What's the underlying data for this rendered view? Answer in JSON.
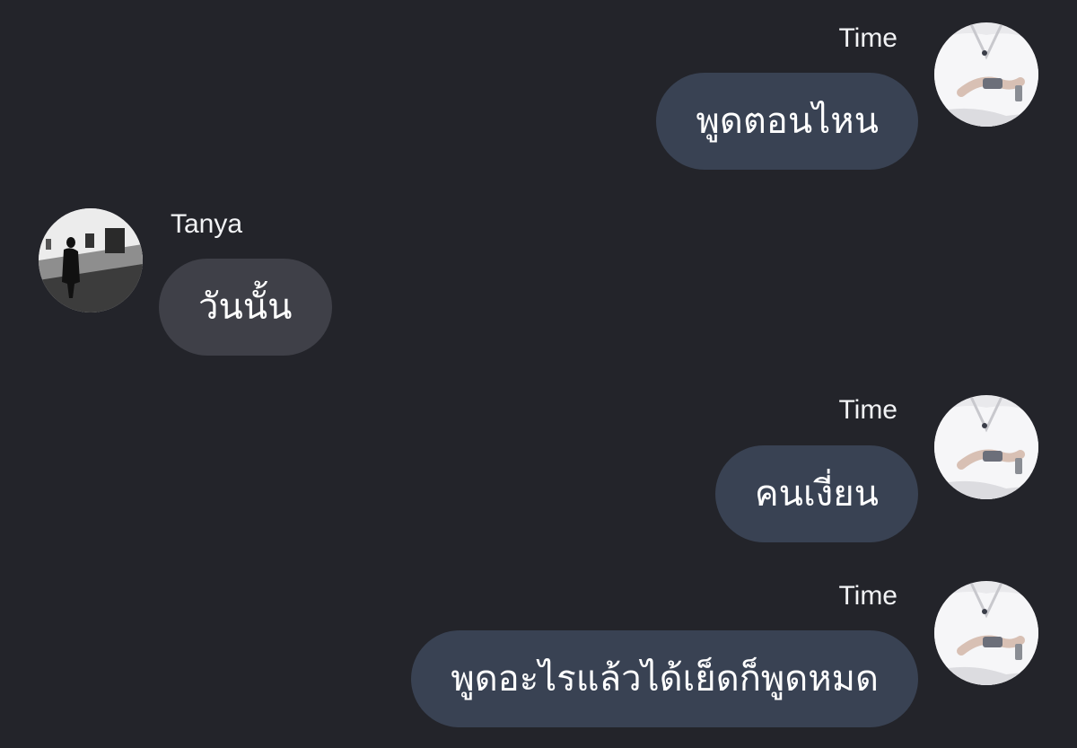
{
  "messages": [
    {
      "sender": "Time",
      "text": "พูดตอนไหน",
      "direction": "outgoing",
      "avatar": "person-white-shirt-phone-avatar"
    },
    {
      "sender": "Tanya",
      "text": "วันนั้น",
      "direction": "incoming",
      "avatar": "gallery-silhouette-avatar"
    },
    {
      "sender": "Time",
      "text": "คนเงี่ยน",
      "direction": "outgoing",
      "avatar": "person-white-shirt-phone-avatar"
    },
    {
      "sender": "Time",
      "text": "พูดอะไรแล้วได้เย็ดก็พูดหมด",
      "direction": "outgoing",
      "avatar": "person-white-shirt-phone-avatar"
    }
  ],
  "colors": {
    "background": "#23242a",
    "outgoing_bubble": "#394253",
    "incoming_bubble": "#3f4048",
    "text": "#ffffff"
  }
}
